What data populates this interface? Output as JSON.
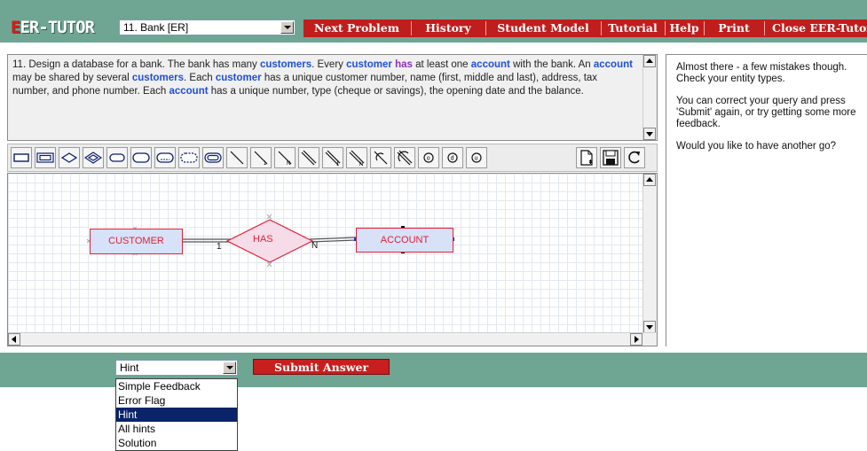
{
  "app": {
    "logo": {
      "first_letter": "E",
      "rest": "ER-TUTOR"
    }
  },
  "header": {
    "problem_select": {
      "value": "11. Bank [ER]"
    },
    "nav": [
      "Next Problem",
      "History",
      "Student Model",
      "Tutorial",
      "Help",
      "Print",
      "Close EER-Tutor"
    ]
  },
  "problem": {
    "segments": [
      {
        "t": "11. Design a database for a bank. The bank has many "
      },
      {
        "t": "customers",
        "k": "entity"
      },
      {
        "t": ". Every "
      },
      {
        "t": "customer",
        "k": "entity"
      },
      {
        "t": " "
      },
      {
        "t": "has",
        "k": "relationship"
      },
      {
        "t": " at least one "
      },
      {
        "t": "account",
        "k": "entity"
      },
      {
        "t": " with the bank. An "
      },
      {
        "t": "account",
        "k": "entity"
      },
      {
        "t": " may be shared by several "
      },
      {
        "t": "customers",
        "k": "entity"
      },
      {
        "t": ". Each "
      },
      {
        "t": "customer",
        "k": "entity"
      },
      {
        "t": " has a unique customer number, name (first, middle and last), address, tax number, and phone number. Each "
      },
      {
        "t": "account",
        "k": "entity"
      },
      {
        "t": " has a unique number, type (cheque or savings), the opening date and the balance."
      }
    ]
  },
  "toolbar": {
    "tools": [
      "entity-tool",
      "weak-entity-tool",
      "relationship-tool",
      "identifying-relationship-tool",
      "attribute-tool",
      "key-attribute-tool",
      "partial-key-attribute-tool",
      "derived-attribute-tool",
      "multivalued-attribute-tool",
      "line-tool",
      "one-cardinality-line-tool",
      "n-cardinality-line-tool",
      "total-participation-line-tool",
      "total-one-line-tool",
      "total-n-line-tool",
      "specialization-line-tool",
      "total-specialization-line-tool",
      "overlap-tool",
      "disjoint-tool",
      "union-tool",
      "new-diagram-tool",
      "save-tool",
      "reload-tool"
    ]
  },
  "diagram": {
    "customer_label": "CUSTOMER",
    "has_label": "HAS",
    "account_label": "ACCOUNT",
    "cardinality_left": "1",
    "cardinality_right": "N"
  },
  "feedback": {
    "paragraphs": [
      "Almost there - a few mistakes though. Check your entity types.",
      "You can correct your query and press 'Submit' again, or try getting some more feedback.",
      "Would you like to have another go?"
    ]
  },
  "bottom": {
    "feedback_level_select": {
      "value": "Hint"
    },
    "submit_label": "Submit Answer",
    "options": [
      "Simple Feedback",
      "Error Flag",
      "Hint",
      "All hints",
      "Solution"
    ],
    "selected_option": "Hint"
  },
  "colors": {
    "bar_green": "#6fa593",
    "brand_red": "#c01d1d",
    "keyword_blue": "#1f4fd8",
    "relationship_purple": "#8b2fb8",
    "diagram_red": "#e0203a",
    "entity_fill": "#d7e1f7",
    "relationship_fill": "#f6dce9",
    "selection_navy": "#0a246a"
  }
}
